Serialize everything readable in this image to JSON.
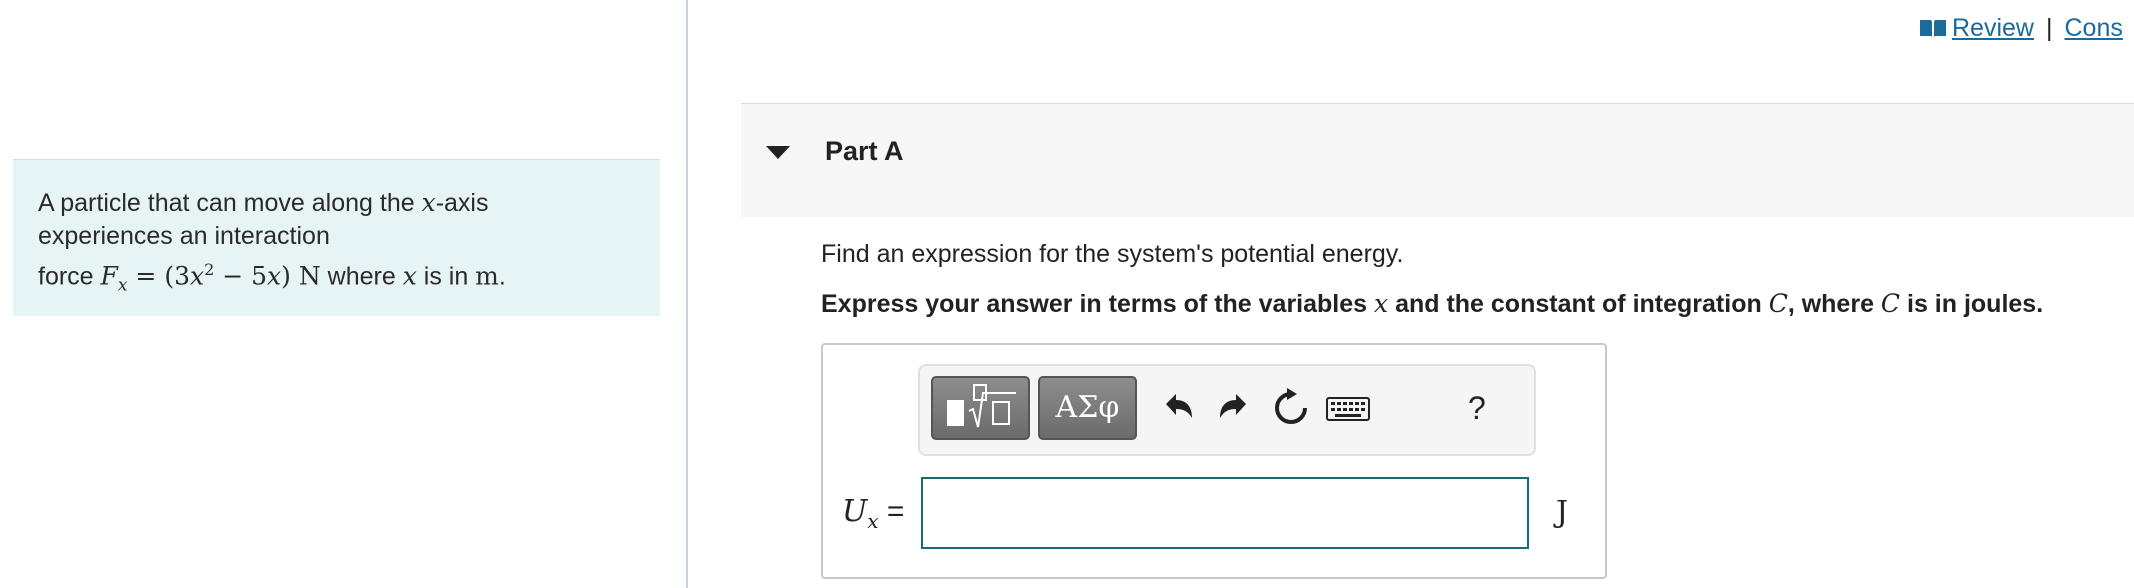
{
  "problem": {
    "line1_pre": "A particle that can move along the ",
    "var_x": "x",
    "line1_post": "-axis",
    "line2": "experiences an interaction",
    "line3_pre": "force ",
    "force_symbol": "F",
    "force_subscript": "x",
    "equals": " = (3",
    "exp2": "2",
    "minus_term": " − 5",
    "unit_N": ") N",
    "where": " where ",
    "is_in": " is in ",
    "unit_m": "m",
    "period": "."
  },
  "top_links": {
    "review": "Review",
    "separator": "|",
    "constants": "Cons"
  },
  "part": {
    "title": "Part A"
  },
  "question": {
    "instruction": "Find an expression for the system's potential energy.",
    "express_pre": "Express your answer in terms of the variables ",
    "express_var": "x",
    "express_mid": " and the constant of integration ",
    "express_const": "C",
    "express_where": ", where ",
    "express_const2": "C",
    "express_post": " is in joules."
  },
  "toolbar": {
    "symbols_label": "ΑΣφ",
    "help_label": "?"
  },
  "answer": {
    "label_symbol": "U",
    "label_subscript": "x",
    "label_equals": " =",
    "value": "",
    "unit": "J"
  },
  "colors": {
    "link": "#1a6b9a",
    "problem_bg": "#e6f4f6",
    "input_border": "#1a6b78"
  }
}
